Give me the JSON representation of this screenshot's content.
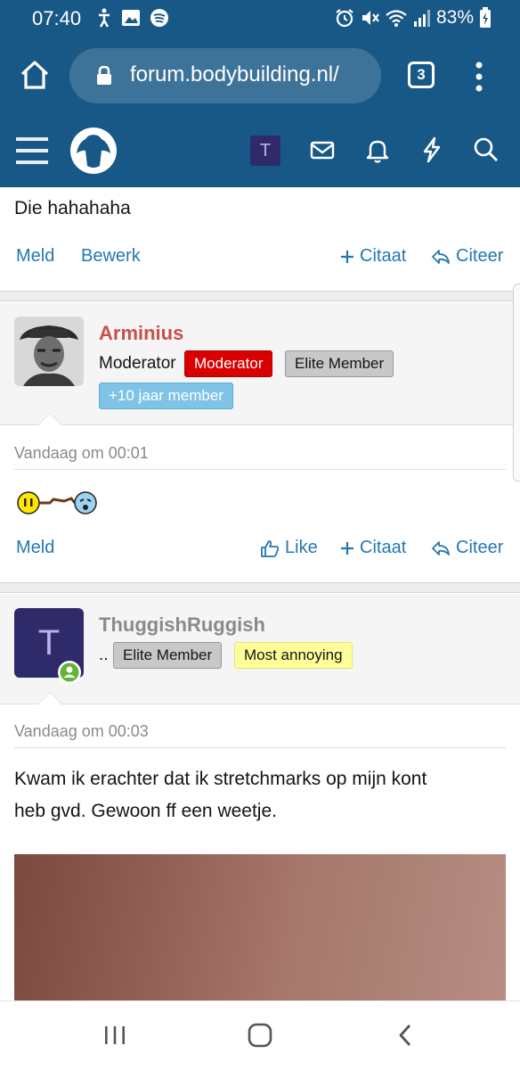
{
  "status_bar": {
    "time": "07:40",
    "battery": "83%",
    "left_icons": [
      "accessibility-icon",
      "image-icon",
      "spotify-icon"
    ],
    "right_icons": [
      "alarm-icon",
      "mute-icon",
      "wifi-icon",
      "signal-icon",
      "battery-icon"
    ]
  },
  "browser": {
    "url": "forum.bodybuilding.nl/",
    "tab_count": "3"
  },
  "forum_nav": {
    "user_initial": "T"
  },
  "posts": [
    {
      "body": "Die hahahaha",
      "actions": {
        "report": "Meld",
        "edit": "Bewerk",
        "multiquote": "Citaat",
        "quote": "Citeer"
      }
    },
    {
      "username": "Arminius",
      "user_title": "Moderator",
      "badges": [
        "Moderator",
        "Elite Member",
        "+10 jaar member"
      ],
      "timestamp": "Vandaag om 00:01",
      "actions": {
        "report": "Meld",
        "like": "Like",
        "multiquote": "Citaat",
        "quote": "Citeer"
      }
    },
    {
      "username": "ThuggishRuggish",
      "user_title": "..",
      "avatar_initial": "T",
      "badges": [
        "Elite Member",
        "Most annoying"
      ],
      "timestamp": "Vandaag om 00:03",
      "body_line1": "Kwam ik erachter dat ik stretchmarks op mijn kont",
      "body_line2": "heb gvd. Gewoon ff een weetje."
    }
  ],
  "colors": {
    "header": "#185886",
    "link": "#2577b1",
    "moderator_name": "#c8504a",
    "moderator_badge": "#d80000",
    "yellow_badge": "#ffff99",
    "blue_badge": "#7fc4e6"
  }
}
